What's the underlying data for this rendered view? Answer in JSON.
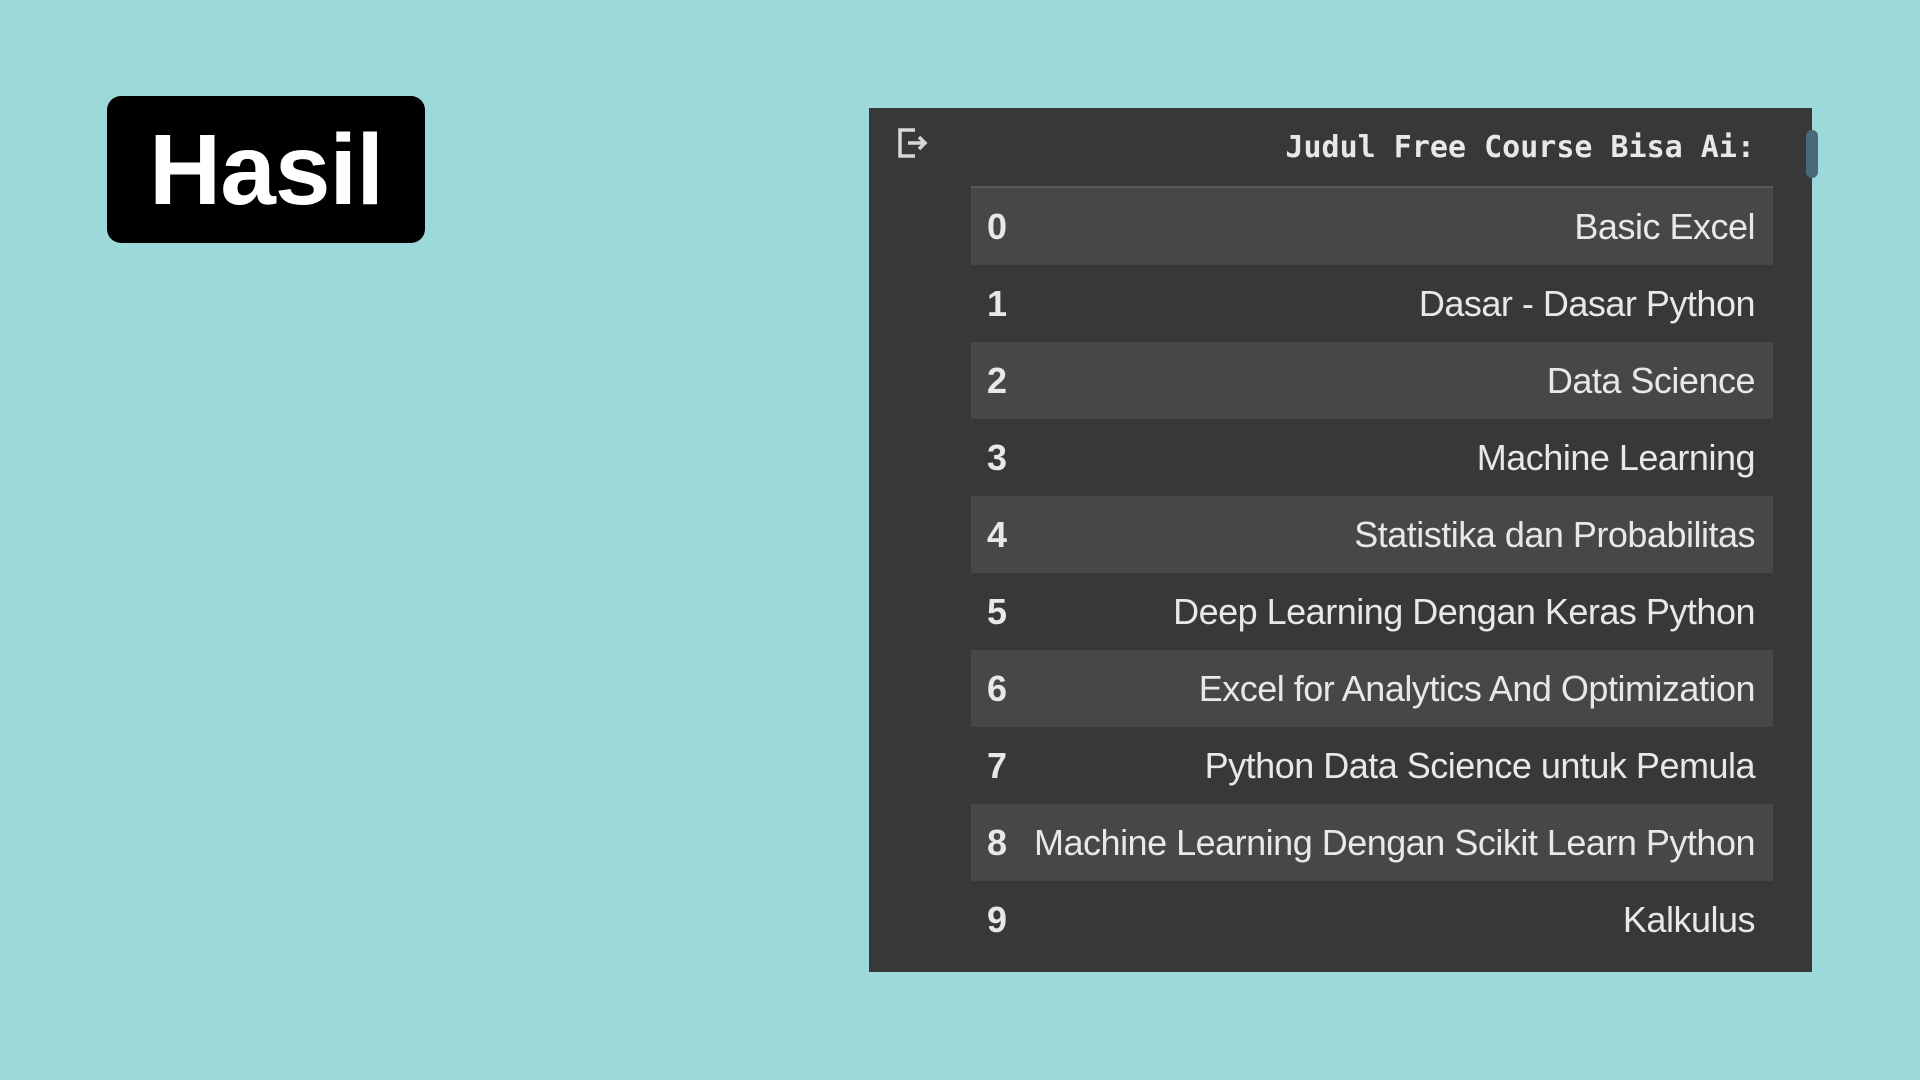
{
  "title": "Hasil",
  "output": {
    "header": "Judul Free Course Bisa Ai:",
    "rows": [
      {
        "index": "0",
        "value": "Basic Excel"
      },
      {
        "index": "1",
        "value": "Dasar - Dasar Python"
      },
      {
        "index": "2",
        "value": "Data Science"
      },
      {
        "index": "3",
        "value": "Machine Learning"
      },
      {
        "index": "4",
        "value": "Statistika dan Probabilitas"
      },
      {
        "index": "5",
        "value": "Deep Learning Dengan Keras Python"
      },
      {
        "index": "6",
        "value": "Excel for Analytics And Optimization"
      },
      {
        "index": "7",
        "value": "Python Data Science untuk Pemula"
      },
      {
        "index": "8",
        "value": "Machine Learning Dengan Scikit Learn Python"
      },
      {
        "index": "9",
        "value": "Kalkulus"
      }
    ]
  },
  "icons": {
    "output": "output-redirect-icon"
  },
  "colors": {
    "background": "#9dd8da",
    "badge": "#000000",
    "panel": "#383838",
    "row_alt": "#474747",
    "text": "#e8e8e8"
  }
}
